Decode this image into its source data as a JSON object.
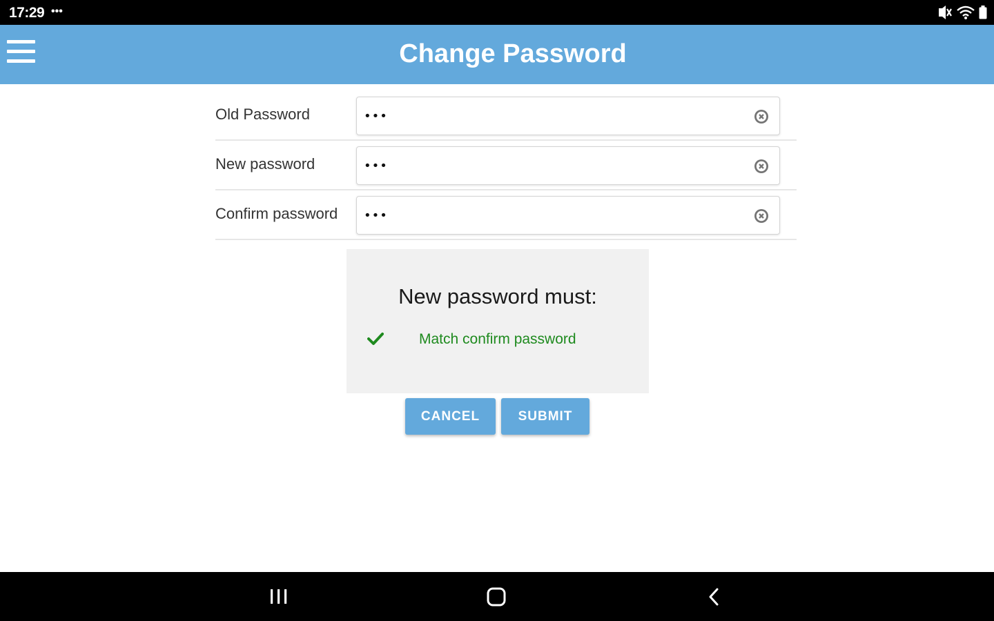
{
  "status_bar": {
    "time": "17:29",
    "notification_dots": "•••",
    "icons": [
      "mute-icon",
      "wifi-icon",
      "battery-icon"
    ]
  },
  "app_bar": {
    "menu_icon": "hamburger-menu-icon",
    "title": "Change Password",
    "color": "#63a9dc"
  },
  "form": {
    "fields": [
      {
        "label": "Old Password",
        "value": "•••"
      },
      {
        "label": "New password",
        "value": "•••"
      },
      {
        "label": "Confirm password",
        "value": "•••"
      }
    ],
    "clear_icon": "clear-circle-icon"
  },
  "requirements": {
    "title": "New password must:",
    "items": [
      {
        "text": "Match confirm password",
        "status": "met",
        "icon": "checkmark-icon",
        "color": "#1e8a1e"
      }
    ]
  },
  "actions": {
    "cancel_label": "CANCEL",
    "submit_label": "SUBMIT"
  },
  "nav_bar": {
    "icons": [
      "recent-apps-icon",
      "home-icon",
      "back-icon"
    ]
  }
}
